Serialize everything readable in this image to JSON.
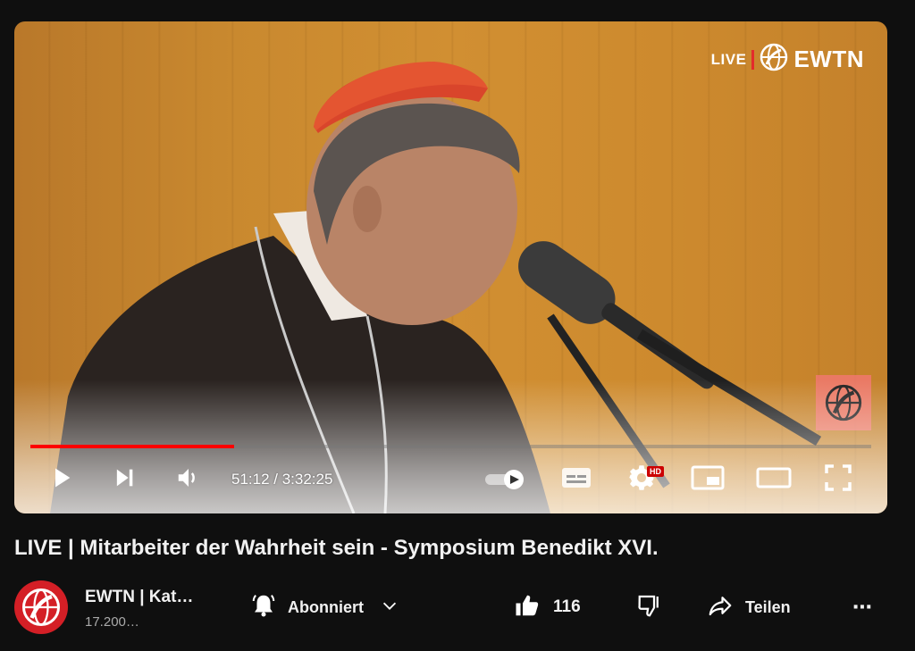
{
  "player": {
    "watermark": {
      "live": "LIVE",
      "brand": "EWTN"
    },
    "progress_fraction": 0.242,
    "time": {
      "current": "51:12",
      "total": "3:32:25"
    },
    "hd_badge": "HD",
    "icons": {
      "play": "play-icon",
      "next": "next-icon",
      "volume": "volume-icon",
      "autoplay": "autoplay-toggle",
      "captions": "captions-icon",
      "settings": "gear-icon",
      "miniplayer": "miniplayer-icon",
      "theater": "theater-icon",
      "fullscreen": "fullscreen-icon"
    }
  },
  "video": {
    "title": "LIVE | Mitarbeiter der Wahrheit sein - Symposium Benedikt XVI."
  },
  "channel": {
    "name": "EWTN | Kat…",
    "subscribers": "17.200…"
  },
  "actions": {
    "subscribe_label": "Abonniert",
    "likes": "116",
    "share_label": "Teilen"
  },
  "colors": {
    "progress_played": "#ff0000",
    "brand_red": "#d41f26",
    "background": "#0f0f0f"
  }
}
